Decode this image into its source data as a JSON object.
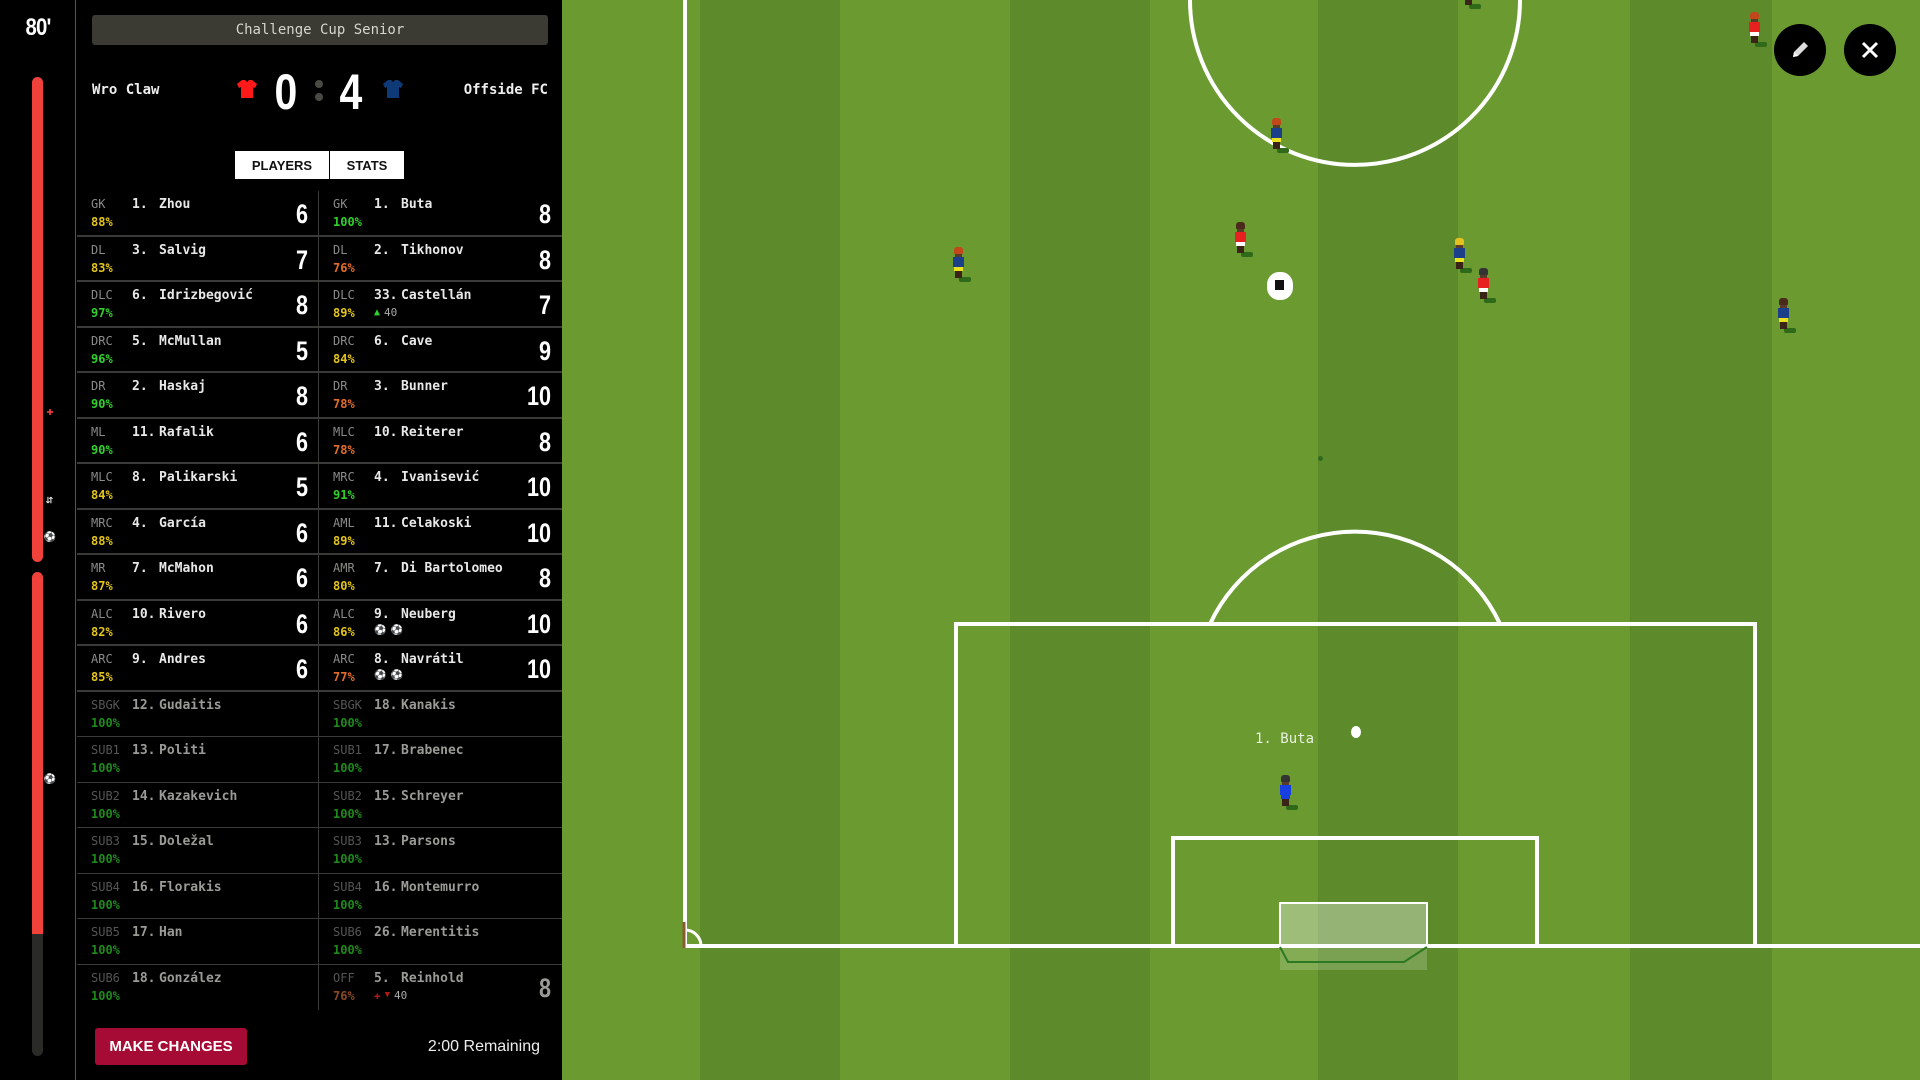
{
  "match": {
    "minute": "80'",
    "competition": "Challenge Cup Senior",
    "home": {
      "name": "Wro Claw",
      "score": "0",
      "shirt_color": "#ff1a1a"
    },
    "away": {
      "name": "Offside FC",
      "score": "4",
      "shirt_color": "#0f3a78"
    }
  },
  "timeline": {
    "played_color": "#f0413a",
    "remaining_color": "#2a2b27",
    "events": [
      {
        "icon": "injury-cross-icon",
        "glyph": "✚"
      },
      {
        "icon": "substitution-icon",
        "glyph": "⇆"
      },
      {
        "icon": "goal-ball-icon",
        "glyph": "⚽"
      },
      {
        "icon": "goal-ball-icon",
        "glyph": "⚽"
      },
      {
        "icon": "goal-ball-icon",
        "glyph": "⚽"
      }
    ]
  },
  "tabs": {
    "players": "PLAYERS",
    "stats": "STATS",
    "active": "players"
  },
  "roster": {
    "home": [
      {
        "pos": "GK",
        "num": "1.",
        "name": "Zhou",
        "cond": "88%",
        "cond_level": "yellow",
        "rating": "6"
      },
      {
        "pos": "DL",
        "num": "3.",
        "name": "Salvig",
        "cond": "83%",
        "cond_level": "yellow",
        "rating": "7"
      },
      {
        "pos": "DLC",
        "num": "6.",
        "name": "Idrizbegović",
        "cond": "97%",
        "cond_level": "green",
        "rating": "8"
      },
      {
        "pos": "DRC",
        "num": "5.",
        "name": "McMullan",
        "cond": "96%",
        "cond_level": "green",
        "rating": "5"
      },
      {
        "pos": "DR",
        "num": "2.",
        "name": "Haskaj",
        "cond": "90%",
        "cond_level": "green",
        "rating": "8"
      },
      {
        "pos": "ML",
        "num": "11.",
        "name": "Rafalik",
        "cond": "90%",
        "cond_level": "green",
        "rating": "6"
      },
      {
        "pos": "MLC",
        "num": "8.",
        "name": "Palikarski",
        "cond": "84%",
        "cond_level": "yellow",
        "rating": "5"
      },
      {
        "pos": "MRC",
        "num": "4.",
        "name": "García",
        "cond": "88%",
        "cond_level": "yellow",
        "rating": "6"
      },
      {
        "pos": "MR",
        "num": "7.",
        "name": "McMahon",
        "cond": "87%",
        "cond_level": "yellow",
        "rating": "6"
      },
      {
        "pos": "ALC",
        "num": "10.",
        "name": "Rivero",
        "cond": "82%",
        "cond_level": "yellow",
        "rating": "6"
      },
      {
        "pos": "ARC",
        "num": "9.",
        "name": "Andres",
        "cond": "85%",
        "cond_level": "yellow",
        "rating": "6"
      },
      {
        "pos": "SBGK",
        "num": "12.",
        "name": "Gudaitis",
        "cond": "100%",
        "cond_level": "dkgreen",
        "rating": "",
        "sub": true
      },
      {
        "pos": "SUB1",
        "num": "13.",
        "name": "Politi",
        "cond": "100%",
        "cond_level": "dkgreen",
        "rating": "",
        "sub": true
      },
      {
        "pos": "SUB2",
        "num": "14.",
        "name": "Kazakevich",
        "cond": "100%",
        "cond_level": "dkgreen",
        "rating": "",
        "sub": true
      },
      {
        "pos": "SUB3",
        "num": "15.",
        "name": "Doležal",
        "cond": "100%",
        "cond_level": "dkgreen",
        "rating": "",
        "sub": true
      },
      {
        "pos": "SUB4",
        "num": "16.",
        "name": "Florakis",
        "cond": "100%",
        "cond_level": "dkgreen",
        "rating": "",
        "sub": true
      },
      {
        "pos": "SUB5",
        "num": "17.",
        "name": "Han",
        "cond": "100%",
        "cond_level": "dkgreen",
        "rating": "",
        "sub": true
      },
      {
        "pos": "SUB6",
        "num": "18.",
        "name": "González",
        "cond": "100%",
        "cond_level": "dkgreen",
        "rating": "",
        "sub": true
      }
    ],
    "away": [
      {
        "pos": "GK",
        "num": "1.",
        "name": "Buta",
        "cond": "100%",
        "cond_level": "green",
        "rating": "8"
      },
      {
        "pos": "DL",
        "num": "2.",
        "name": "Tikhonov",
        "cond": "76%",
        "cond_level": "orange",
        "rating": "8"
      },
      {
        "pos": "DLC",
        "num": "33.",
        "name": "Castellán",
        "cond": "89%",
        "cond_level": "yellow",
        "rating": "7",
        "extra": {
          "type": "sub-on",
          "minute": "40"
        }
      },
      {
        "pos": "DRC",
        "num": "6.",
        "name": "Cave",
        "cond": "84%",
        "cond_level": "yellow",
        "rating": "9"
      },
      {
        "pos": "DR",
        "num": "3.",
        "name": "Bunner",
        "cond": "78%",
        "cond_level": "orange",
        "rating": "10"
      },
      {
        "pos": "MLC",
        "num": "10.",
        "name": "Reiterer",
        "cond": "78%",
        "cond_level": "orange",
        "rating": "8"
      },
      {
        "pos": "MRC",
        "num": "4.",
        "name": "Ivanisević",
        "cond": "91%",
        "cond_level": "green",
        "rating": "10"
      },
      {
        "pos": "AML",
        "num": "11.",
        "name": "Celakoski",
        "cond": "89%",
        "cond_level": "yellow",
        "rating": "10"
      },
      {
        "pos": "AMR",
        "num": "7.",
        "name": "Di Bartolomeo",
        "cond": "80%",
        "cond_level": "yellow",
        "rating": "8"
      },
      {
        "pos": "ALC",
        "num": "9.",
        "name": "Neuberg",
        "cond": "86%",
        "cond_level": "yellow",
        "rating": "10",
        "extra": {
          "type": "goals",
          "count": 2
        }
      },
      {
        "pos": "ARC",
        "num": "8.",
        "name": "Navrátil",
        "cond": "77%",
        "cond_level": "orange",
        "rating": "10",
        "extra": {
          "type": "goals",
          "count": 2
        }
      },
      {
        "pos": "SBGK",
        "num": "18.",
        "name": "Kanakis",
        "cond": "100%",
        "cond_level": "dkgreen",
        "rating": "",
        "sub": true
      },
      {
        "pos": "SUB1",
        "num": "17.",
        "name": "Brabenec",
        "cond": "100%",
        "cond_level": "dkgreen",
        "rating": "",
        "sub": true
      },
      {
        "pos": "SUB2",
        "num": "15.",
        "name": "Schreyer",
        "cond": "100%",
        "cond_level": "dkgreen",
        "rating": "",
        "sub": true
      },
      {
        "pos": "SUB3",
        "num": "13.",
        "name": "Parsons",
        "cond": "100%",
        "cond_level": "dkgreen",
        "rating": "",
        "sub": true
      },
      {
        "pos": "SUB4",
        "num": "16.",
        "name": "Montemurro",
        "cond": "100%",
        "cond_level": "dkgreen",
        "rating": "",
        "sub": true
      },
      {
        "pos": "SUB6",
        "num": "26.",
        "name": "Merentitis",
        "cond": "100%",
        "cond_level": "dkgreen",
        "rating": "",
        "sub": true
      },
      {
        "pos": "OFF",
        "num": "5.",
        "name": "Reinhold",
        "cond": "76%",
        "cond_level": "dkorange",
        "rating": "8",
        "sub": true,
        "extra": {
          "type": "injured-off",
          "minute": "40"
        }
      }
    ]
  },
  "footer": {
    "make_changes": "MAKE CHANGES",
    "remaining": "2:00 Remaining"
  },
  "pitch": {
    "highlighted_player_label": "1. Buta",
    "colors": {
      "grass_light": "#6a9a30",
      "grass_dark": "#5d8b2c",
      "lines": "#ffffff"
    }
  },
  "controls": {
    "edit_icon": "pencil-icon",
    "close_icon": "close-icon"
  }
}
